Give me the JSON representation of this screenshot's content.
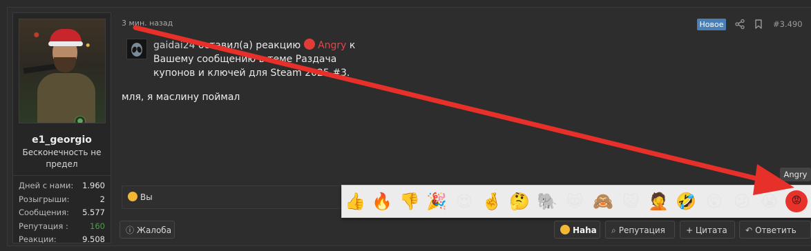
{
  "user": {
    "username": "e1_georgio",
    "title": "Бесконечность не предел",
    "stats": [
      {
        "label": "Дней с нами:",
        "value": "1.960"
      },
      {
        "label": "Розыгрыши:",
        "value": "2"
      },
      {
        "label": "Сообщения:",
        "value": "5.577"
      },
      {
        "label": "Репутация :",
        "value": "160"
      },
      {
        "label": "Реакции:",
        "value": "9.508"
      }
    ]
  },
  "post": {
    "timestamp": "3 мин. назад",
    "badge": "Новое",
    "number": "#3.490",
    "alert": {
      "user": "gaidai24",
      "action": " оставил(а) реакцию ",
      "reaction": "Angry",
      "to": " к Вашему сообщению в теме Раздача купонов и ключей для Steam 2025 #3."
    },
    "message": "мля, я маслину поймал"
  },
  "reactions_bar": {
    "label": "Вы"
  },
  "emoji_popup": {
    "items": [
      "👍",
      "🔥",
      "👎",
      "🎉",
      "😍",
      "🤞",
      "🤔",
      "🐘",
      "😸",
      "🙈",
      "😺",
      "🤦",
      "🤣",
      "😲",
      "😕",
      "😭",
      "😡"
    ],
    "tooltip": "Angry"
  },
  "footer": {
    "report": "Жалоба",
    "haha": "Haha",
    "reputation": "Репутация",
    "quote": "+ Цитата",
    "reply": "Ответить"
  },
  "colors": {
    "arrow": "#e8302b",
    "badge": "#4a7fb5",
    "angry_text": "#e0464d"
  }
}
